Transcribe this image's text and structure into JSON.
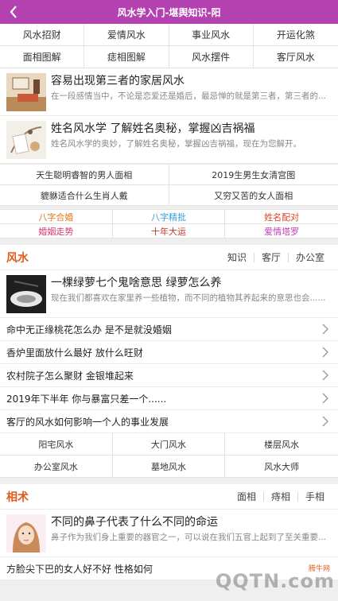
{
  "header": {
    "title": "风水学入门-堪舆知识-阳"
  },
  "top_grid": [
    "风水招财",
    "爱情风水",
    "事业风水",
    "开运化煞",
    "面相图解",
    "痣相图解",
    "风水摆件",
    "客厅风水"
  ],
  "featured": [
    {
      "title": "容易出现第三者的家居风水",
      "desc": "在一段感情当中，不论是恋爱还是婚后，最忌惮的就是第三者，第三者的..."
    },
    {
      "title": "姓名风水学 了解姓名奥秘，掌握凶吉祸福",
      "desc": "姓名风水学的奥妙，了解姓名奥秘，掌握凶吉祸福，现在为您解开。"
    }
  ],
  "two_col": [
    "天生聪明睿智的男人面相",
    "2019生男生女清宫图",
    "貔貅适合什么生肖人戴",
    "又穷又苦的女人面相"
  ],
  "colored_links": [
    {
      "label": "八字合婚",
      "color": "#e0781e"
    },
    {
      "label": "八字精批",
      "color": "#3aa0d8"
    },
    {
      "label": "姓名配对",
      "color": "#e0422a"
    },
    {
      "label": "婚姻走势",
      "color": "#d8366f"
    },
    {
      "label": "十年大运",
      "color": "#c0392b"
    },
    {
      "label": "爱情塔罗",
      "color": "#c03fb5"
    }
  ],
  "fengshui": {
    "title": "风水",
    "links": [
      "知识",
      "客厅",
      "办公室"
    ],
    "featured": {
      "title": "一棵绿萝七个鬼啥意思 绿萝怎么养",
      "desc": "现在我们都喜欢在家里养一些植物，而不同的植物其养起来的意思也会......"
    },
    "list": [
      "命中无正缘桃花怎么办 是不是就没婚姻",
      "香炉里面放什么最好 放什么旺财",
      "农村院子怎么聚财 金银堆起来",
      "2019年下半年 你与暴富只差一个......",
      "客厅的风水如何影响一个人的事业发展"
    ],
    "grid": [
      "阳宅风水",
      "大门风水",
      "楼层风水",
      "办公室风水",
      "墓地风水",
      "风水大师"
    ]
  },
  "xiangshu": {
    "title": "相术",
    "links": [
      "面相",
      "痔相",
      "手相"
    ],
    "featured": {
      "title": "不同的鼻子代表了什么不同的命运",
      "desc": "鼻子作为我们身上重要的器官之一，可以说在我们五官上起到了至关重要..."
    },
    "list": [
      "方脸尖下巴的女人好不好 性格如何"
    ]
  },
  "watermark": {
    "small": "腾牛网",
    "big": "QQTN.com"
  }
}
